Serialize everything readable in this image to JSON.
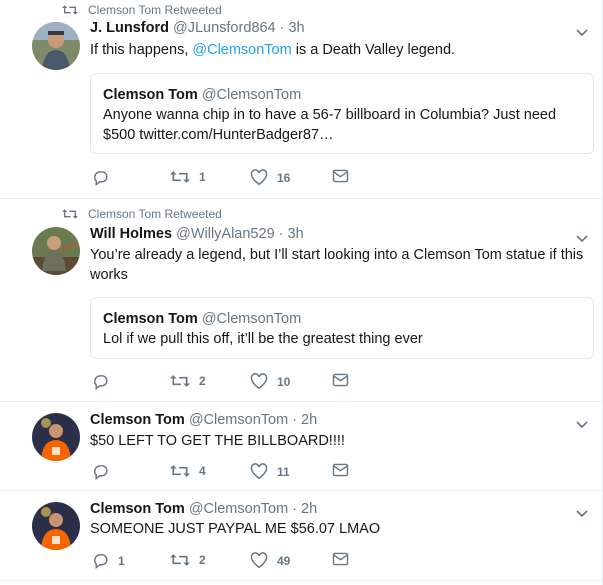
{
  "tweets": [
    {
      "context": "Clemson Tom Retweeted",
      "name": "J. Lunsford",
      "handle": "@JLunsford864",
      "time": "3h",
      "text_before": "If this happens, ",
      "mention": "@ClemsonTom",
      "text_after": " is a Death Valley legend.",
      "quote": {
        "name": "Clemson Tom",
        "handle": "@ClemsonTom",
        "line1": "Anyone wanna chip in to have a 56-7 billboard in Columbia? Just need",
        "line2": "$500 twitter.com/HunterBadger87…"
      },
      "reply_count": "",
      "retweet_count": "1",
      "like_count": "16"
    },
    {
      "context": "Clemson Tom Retweeted",
      "name": "Will Holmes",
      "handle": "@WillyAlan529",
      "time": "3h",
      "line1": "You’re already a legend, but I’ll start looking into a Clemson Tom statue if this",
      "line2": "works",
      "quote": {
        "name": "Clemson Tom",
        "handle": "@ClemsonTom",
        "line1": "Lol if we pull this off, it’ll be the greatest thing ever"
      },
      "reply_count": "",
      "retweet_count": "2",
      "like_count": "10"
    },
    {
      "name": "Clemson Tom",
      "handle": "@ClemsonTom",
      "time": "2h",
      "line1": "$50 LEFT TO GET THE BILLBOARD!!!!",
      "reply_count": "",
      "retweet_count": "4",
      "like_count": "11"
    },
    {
      "name": "Clemson Tom",
      "handle": "@ClemsonTom",
      "time": "2h",
      "line1": "SOMEONE JUST PAYPAL ME $56.07 LMAO",
      "reply_count": "1",
      "retweet_count": "2",
      "like_count": "49"
    }
  ],
  "separator": " · ",
  "colors": {
    "link": "#1da1f2",
    "muted": "#657786",
    "border": "#e1e8ed"
  },
  "icons": [
    "retweet-icon",
    "reply-icon",
    "like-icon",
    "message-icon",
    "chevron-down-icon"
  ]
}
